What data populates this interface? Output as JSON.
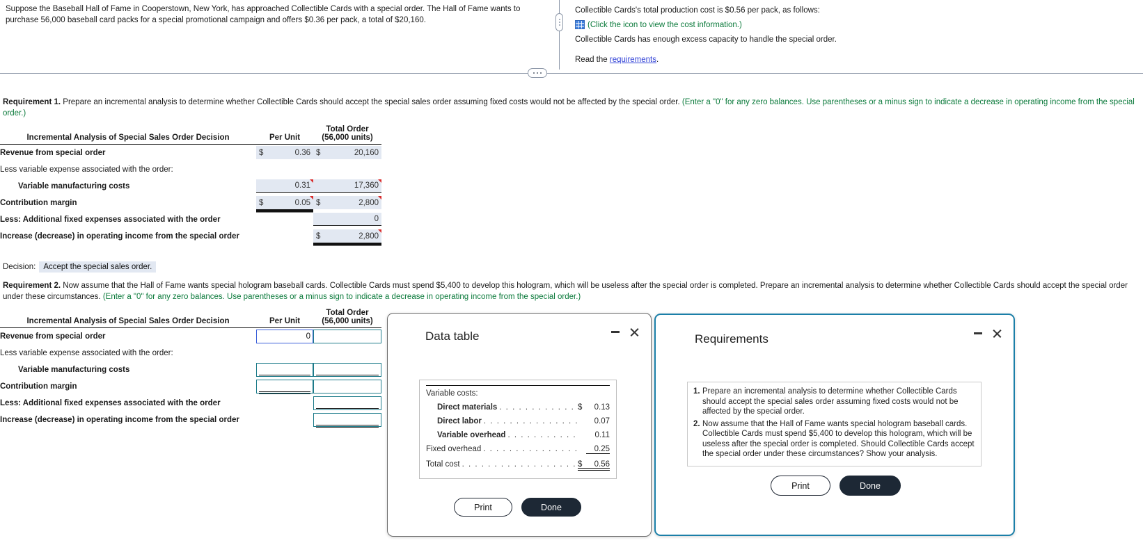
{
  "problem": {
    "left_text": "Suppose the Baseball Hall of Fame in Cooperstown, New York, has approached Collectible Cards with a special order. The Hall of Fame wants to purchase 56,000 baseball card packs for a special promotional campaign and offers $0.36 per pack, a total of $20,160.",
    "right_line1": "Collectible Cards's total production cost is $0.56 per pack, as follows:",
    "right_icon_link": "(Click the icon to view the cost information.)",
    "right_line3": "Collectible Cards has enough excess capacity to handle the special order.",
    "read_prefix": "Read the ",
    "read_link": "requirements",
    "read_suffix": "."
  },
  "requirement1": {
    "label": "Requirement 1.",
    "text": " Prepare an incremental analysis to determine whether Collectible Cards should accept the special sales order assuming fixed costs would not be affected by the special order. ",
    "hint": "(Enter a \"0\" for any zero balances. Use parentheses or a minus sign to indicate a decrease in operating income from the special order.)"
  },
  "requirement2": {
    "label": "Requirement 2.",
    "text": " Now assume that the Hall of Fame wants special hologram baseball cards. Collectible Cards must spend $5,400 to develop this hologram, which will be useless after the special order is completed. Prepare an incremental analysis to determine whether Collectible Cards should accept the special order under these circumstances. ",
    "hint": "(Enter a \"0\" for any zero balances. Use parentheses or a minus sign to indicate a decrease in operating income from the special order.)"
  },
  "table1": {
    "header_main": "Incremental Analysis of Special Sales Order Decision",
    "header_perunit": "Per Unit",
    "header_total_line1": "Total Order",
    "header_total_line2": "(56,000 units)",
    "rows": [
      {
        "label": "Revenue from special order",
        "bold": true,
        "indent": false,
        "per_unit": {
          "dollar": "$",
          "value": "0.36",
          "underline": "none",
          "flag": false
        },
        "total": {
          "dollar": "$",
          "value": "20,160",
          "underline": "none",
          "flag": false
        }
      },
      {
        "label": "Less variable expense associated with the order:",
        "bold": false,
        "indent": false,
        "per_unit": null,
        "total": null
      },
      {
        "label": "Variable manufacturing costs",
        "bold": true,
        "indent": true,
        "per_unit": {
          "dollar": "",
          "value": "0.31",
          "underline": "single",
          "flag": true
        },
        "total": {
          "dollar": "",
          "value": "17,360",
          "underline": "single",
          "flag": true
        }
      },
      {
        "label": "Contribution margin",
        "bold": true,
        "indent": false,
        "per_unit": {
          "dollar": "$",
          "value": "0.05",
          "underline": "double",
          "flag": true
        },
        "total": {
          "dollar": "$",
          "value": "2,800",
          "underline": "none",
          "flag": true
        }
      },
      {
        "label": "Less: Additional fixed expenses associated with the order",
        "bold": true,
        "indent": false,
        "per_unit": null,
        "total": {
          "dollar": "",
          "value": "0",
          "underline": "single",
          "flag": false
        }
      },
      {
        "label": "Increase (decrease) in operating income from the special order",
        "bold": true,
        "indent": false,
        "per_unit": null,
        "total": {
          "dollar": "$",
          "value": "2,800",
          "underline": "double",
          "flag": true
        }
      }
    ]
  },
  "decision": {
    "label": "Decision:",
    "value": "Accept the special sales order."
  },
  "table2": {
    "header_main": "Incremental Analysis of Special Sales Order Decision",
    "header_perunit": "Per Unit",
    "header_total_line1": "Total Order",
    "header_total_line2": "(56,000 units)",
    "rows": [
      {
        "label": "Revenue from special order",
        "bold": true,
        "indent": false,
        "per_unit": {
          "value": "0",
          "underline": "none",
          "focus": true
        },
        "total": {
          "value": "",
          "underline": "none",
          "focus": false
        }
      },
      {
        "label": "Less variable expense associated with the order:",
        "bold": false,
        "indent": false,
        "per_unit": null,
        "total": null
      },
      {
        "label": "Variable manufacturing costs",
        "bold": true,
        "indent": true,
        "per_unit": {
          "value": "",
          "underline": "single",
          "focus": false
        },
        "total": {
          "value": "",
          "underline": "single",
          "focus": false
        }
      },
      {
        "label": "Contribution margin",
        "bold": true,
        "indent": false,
        "per_unit": {
          "value": "",
          "underline": "double",
          "focus": false
        },
        "total": {
          "value": "",
          "underline": "none",
          "focus": false
        }
      },
      {
        "label": "Less: Additional fixed expenses associated with the order",
        "bold": true,
        "indent": false,
        "per_unit": null,
        "total": {
          "value": "",
          "underline": "single",
          "focus": false
        }
      },
      {
        "label": "Increase (decrease) in operating income from the special order",
        "bold": true,
        "indent": false,
        "per_unit": null,
        "total": {
          "value": "",
          "underline": "double",
          "focus": false
        }
      }
    ]
  },
  "data_table_modal": {
    "title": "Data table",
    "heading": "Variable costs:",
    "lines": [
      {
        "name": "Direct materials",
        "indent": true,
        "dollar": "$",
        "amount": "0.13",
        "rule": "none"
      },
      {
        "name": "Direct labor",
        "indent": true,
        "dollar": "",
        "amount": "0.07",
        "rule": "none"
      },
      {
        "name": "Variable overhead",
        "indent": true,
        "dollar": "",
        "amount": "0.11",
        "rule": "none"
      },
      {
        "name": "Fixed overhead",
        "indent": false,
        "dollar": "",
        "amount": "0.25",
        "rule": "single"
      },
      {
        "name": "Total cost",
        "indent": false,
        "dollar": "$",
        "amount": "0.56",
        "rule": "double"
      }
    ],
    "print_label": "Print",
    "done_label": "Done"
  },
  "requirements_modal": {
    "title": "Requirements",
    "items": [
      {
        "num": "1.",
        "text": "Prepare an incremental analysis to determine whether Collectible Cards should accept the special sales order assuming fixed costs would not be affected by the special order."
      },
      {
        "num": "2.",
        "text": "Now assume that the Hall of Fame wants special hologram baseball cards. Collectible Cards must spend $5,400 to develop this hologram, which will be useless after the special order is completed. Should Collectible Cards accept the special order under these circumstances? Show your analysis."
      }
    ],
    "print_label": "Print",
    "done_label": "Done"
  },
  "colors": {
    "value_cell_bg": "#e2e8f2",
    "input_border": "#1d7b8a",
    "input_focus_border": "#3a5fd9",
    "green_hint": "#0b7a3b",
    "link_blue": "#2e3fd6",
    "modal_active_border": "#1b7fa8",
    "done_button_bg": "#1d2835",
    "flag_red": "#d92b2b"
  }
}
